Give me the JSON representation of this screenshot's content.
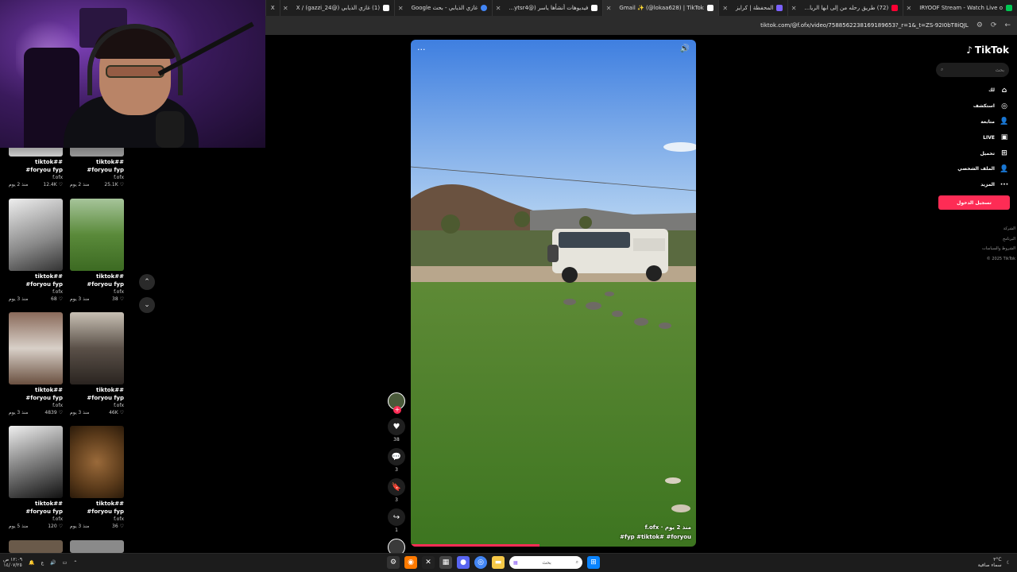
{
  "browser": {
    "tabs": [
      {
        "title": "IRYOOF Stream - Watch Live o",
        "color": "#00c853",
        "active": false
      },
      {
        "title": "(72) طريق رحله من إلى ابها الريا...",
        "color": "#ff0033",
        "active": false
      },
      {
        "title": "المحفظة | كرايز",
        "color": "#7b61ff",
        "active": false
      },
      {
        "title": "Gmail ✨ (@lokaa628) | TikTok",
        "color": "#ffffff",
        "active": true
      },
      {
        "title": "فيديوهات أنشأها ياسر (@ytsr4...",
        "color": "#ffffff",
        "active": false
      },
      {
        "title": "غازي الذيابي - بحث Google",
        "color": "#4285f4",
        "active": false
      },
      {
        "title": "(1) غازي الذيابي (@gazzi_24) / X",
        "color": "#ffffff",
        "active": false
      },
      {
        "title": "X",
        "color": "#ffffff",
        "active": false
      }
    ],
    "url": "tiktok.com/@f.ofx/video/7588562238169189653?_r=1&_t=ZS-92I0bT8iQJL",
    "nav_icons": {
      "back": "←",
      "reload": "⟳",
      "settings": "⚙"
    }
  },
  "left_grid": {
    "columns": [
      [
        {
          "caption": "#tiktok# #foryou",
          "hashtag2": "fyp",
          "user": "f.ofx",
          "views": "25.1K",
          "age": "منذ 2 يوم"
        },
        {
          "caption": "#tiktok# #foryou",
          "hashtag2": "fyp",
          "user": "f.ofx",
          "views": "38",
          "age": "منذ 3 يوم"
        },
        {
          "caption": "#tiktok# #foryou",
          "hashtag2": "fyp",
          "user": "f.ofx",
          "views": "46K",
          "age": "منذ 3 يوم"
        },
        {
          "caption": "#tiktok# #foryou",
          "hashtag2": "fyp",
          "user": "f.ofx",
          "views": "36",
          "age": "منذ 3 يوم"
        }
      ],
      [
        {
          "caption": "#tiktok# #foryou",
          "hashtag2": "fyp",
          "user": "f.ofx",
          "views": "12.4K",
          "age": "منذ 2 يوم"
        },
        {
          "caption": "#tiktok# #foryou",
          "hashtag2": "fyp",
          "user": "f.ofx",
          "views": "68",
          "age": "منذ 3 يوم"
        },
        {
          "caption": "#tiktok# #foryou",
          "hashtag2": "fyp",
          "user": "f.ofx",
          "views": "4839",
          "age": "منذ 3 يوم"
        },
        {
          "caption": "#tiktok# #foryou",
          "hashtag2": "fyp",
          "user": "f.ofx",
          "views": "120",
          "age": "منذ 5 يوم"
        }
      ]
    ],
    "scroll_up": "⌃",
    "scroll_down": "⌄"
  },
  "player": {
    "more": "···",
    "volume": "🔊",
    "overlay_user": "f.ofx · منذ 2 يوم",
    "overlay_caption": "#fyp #tiktok# #foryou",
    "progress": 0.45
  },
  "actions": {
    "like_count": "38",
    "comment_count": "3",
    "save_count": "3",
    "share_count": "1",
    "icons": {
      "like": "♥",
      "comment": "💬",
      "save": "🔖",
      "share": "↪"
    }
  },
  "tiktok_nav": {
    "logo": "TikTok",
    "search_placeholder": "بحث",
    "items": [
      {
        "label": "لك",
        "icon": "⌂"
      },
      {
        "label": "استكشف",
        "icon": "◎"
      },
      {
        "label": "متابعة",
        "icon": "👤"
      },
      {
        "label": "LIVE",
        "icon": "▣"
      },
      {
        "label": "تحميل",
        "icon": "⊞"
      },
      {
        "label": "الملف الشخصي",
        "icon": "👤"
      },
      {
        "label": "المزيد",
        "icon": "···"
      }
    ],
    "login_label": "تسجيل الدخول",
    "footer": [
      "الشركة",
      "البرنامج",
      "الشروط والسياسات",
      "© 2025 TikTok"
    ]
  },
  "taskbar": {
    "left_text": "٣°C",
    "left_sub": "سماء صافية",
    "search_placeholder": "بحث",
    "time": "١٢:٠٩ ص",
    "date": "١٤/٠٧/٢٥",
    "lang": "ع"
  }
}
